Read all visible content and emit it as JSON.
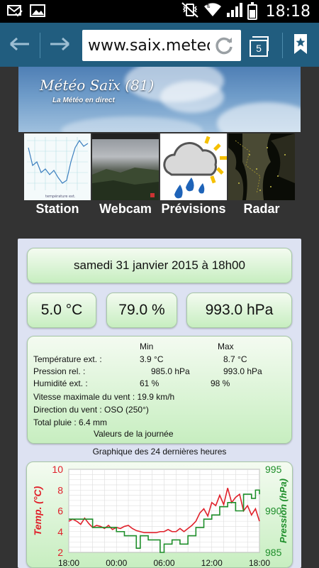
{
  "status_bar": {
    "time": "18:18",
    "left_icons": [
      "mail-checked-icon",
      "image-icon"
    ],
    "right_icons": [
      "vibrate-mute-icon",
      "wifi-icon",
      "signal-icon",
      "battery-icon"
    ]
  },
  "browser": {
    "url": "www.saix.meteo",
    "tab_count": "5",
    "icons": [
      "back-arrow-icon",
      "forward-arrow-icon",
      "reload-icon",
      "tabs-icon",
      "bookmark-icon"
    ],
    "toolbar_color": "#215d7f"
  },
  "banner": {
    "title": "Météo Saïx (81)",
    "subtitle": "La Météo en direct"
  },
  "nav": {
    "items": [
      {
        "label": "Station"
      },
      {
        "label": "Webcam"
      },
      {
        "label": "Prévisions"
      },
      {
        "label": "Radar"
      }
    ]
  },
  "weather": {
    "date": "samedi 31 janvier 2015 à 18h00",
    "temperature": "5.0 °C",
    "humidity": "79.0 %",
    "pressure": "993.0 hPa",
    "stats": {
      "min_header": "Min",
      "max_header": "Max",
      "temp_label": "Température ext. :",
      "temp_min": "3.9 °C",
      "temp_max": "8.7 °C",
      "press_label": "Pression rel. :",
      "press_min": "985.0 hPa",
      "press_max": "993.0 hPa",
      "hum_label": "Humidité ext. :",
      "hum_min": "61 %",
      "hum_max": "98 %",
      "wind_max": "Vitesse maximale du vent : 19.9 km/h",
      "wind_dir": "Direction du vent : OSO (250°)",
      "rain": "Total pluie : 6.4 mm",
      "footer": "Valeurs de la journée"
    },
    "chart_caption": "Graphique des 24 dernières heures"
  },
  "chart_data": {
    "type": "line",
    "title": "Graphique des 24 dernières heures",
    "x_tick_labels": [
      "18:00",
      "00:00",
      "06:00",
      "12:00",
      "18:00"
    ],
    "x_range_hours": [
      0,
      24
    ],
    "ylabel_left": "Temp. (°C)",
    "ylim_left": [
      2,
      10
    ],
    "yticks_left": [
      2,
      4,
      6,
      8,
      10
    ],
    "ylabel_right": "Pression (hPa)",
    "ylim_right": [
      985,
      995
    ],
    "yticks_right": [
      985,
      990,
      995
    ],
    "grid": true,
    "colors": {
      "temperature": "#e0202a",
      "pressure": "#1e8e2a"
    },
    "series": [
      {
        "name": "Temp.",
        "axis": "left",
        "x": [
          0,
          0.5,
          1,
          1.5,
          2,
          2.5,
          3,
          3.5,
          4,
          4.5,
          5,
          5.5,
          6,
          6.5,
          7,
          7.5,
          8,
          8.5,
          9,
          9.5,
          10,
          10.5,
          11,
          11.5,
          12,
          12.5,
          13,
          13.5,
          14,
          14.5,
          15,
          15.5,
          16,
          16.5,
          17,
          17.5,
          18,
          18.5,
          19,
          19.5,
          20,
          20.5,
          21,
          21.5,
          22,
          22.5,
          23,
          23.5,
          24
        ],
        "values": [
          5.0,
          5.2,
          5.0,
          4.7,
          5.3,
          4.8,
          4.4,
          4.6,
          4.5,
          4.3,
          4.6,
          4.2,
          4.4,
          4.3,
          4.5,
          4.6,
          4.3,
          4.1,
          4.0,
          3.9,
          3.9,
          3.9,
          3.9,
          4.0,
          4.0,
          4.2,
          4.0,
          4.0,
          4.3,
          4.0,
          4.3,
          4.6,
          5.0,
          5.8,
          6.2,
          5.5,
          6.8,
          6.5,
          7.5,
          6.6,
          8.2,
          6.8,
          7.3,
          7.6,
          6.0,
          6.5,
          5.6,
          6.2,
          5.0
        ]
      },
      {
        "name": "Pression",
        "axis": "right",
        "x": [
          0,
          1,
          2,
          3,
          4,
          5,
          6,
          7,
          8,
          8.5,
          9,
          10,
          11,
          11.5,
          12,
          13,
          14,
          15,
          16,
          17,
          18,
          19,
          20,
          21,
          22,
          23,
          23.5,
          24
        ],
        "values": [
          989,
          989,
          989,
          988,
          988,
          988,
          987.5,
          987,
          987,
          985.5,
          987,
          986.5,
          986.5,
          985,
          986,
          986.5,
          986,
          987,
          988,
          989,
          989.5,
          990.5,
          991,
          990,
          992,
          991.5,
          992.5,
          992
        ]
      }
    ]
  }
}
